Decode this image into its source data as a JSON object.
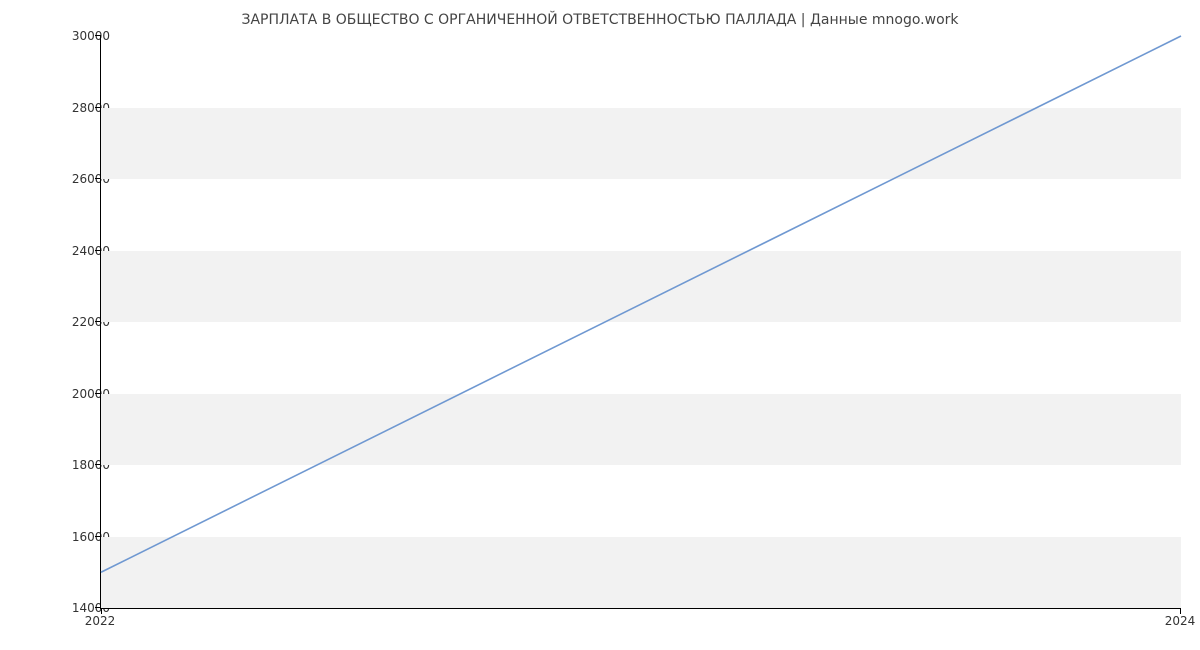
{
  "chart_data": {
    "type": "line",
    "title": "ЗАРПЛАТА В ОБЩЕСТВО С ОРГАНИЧЕННОЙ ОТВЕТСТВЕННОСТЬЮ ПАЛЛАДА | Данные mnogo.work",
    "x": [
      2022,
      2024
    ],
    "y": [
      15000,
      30000
    ],
    "xlabel": "",
    "ylabel": "",
    "xticks": [
      2022,
      2024
    ],
    "yticks": [
      14000,
      16000,
      18000,
      20000,
      22000,
      24000,
      26000,
      28000,
      30000
    ],
    "ylim": [
      14000,
      30000
    ],
    "xlim_fraction": [
      0,
      1
    ],
    "line_color": "#6f98d1",
    "band_color": "#f2f2f2"
  }
}
